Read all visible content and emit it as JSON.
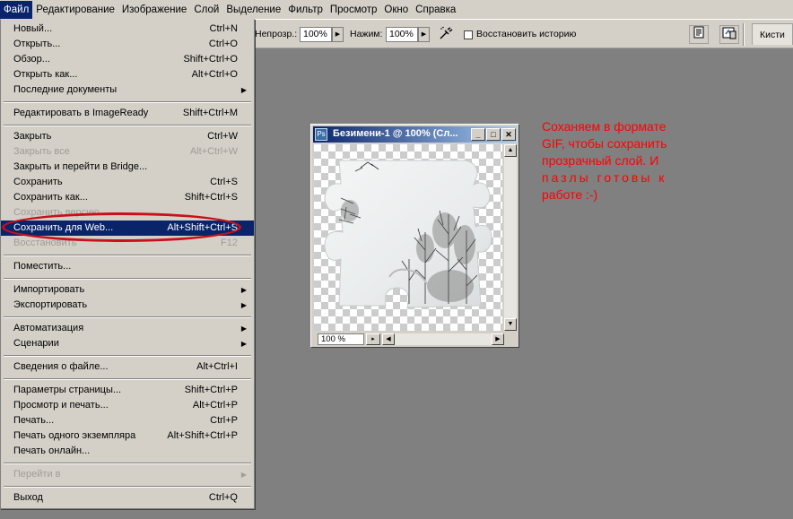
{
  "menubar": {
    "items": [
      "Файл",
      "Редактирование",
      "Изображение",
      "Слой",
      "Выделение",
      "Фильтр",
      "Просмотр",
      "Окно",
      "Справка"
    ]
  },
  "options": {
    "opacity_label": "Непрозр.:",
    "opacity_value": "100%",
    "flow_label": "Нажим:",
    "flow_value": "100%",
    "restore_history_label": "Восстановить историю",
    "brushes_tab": "Кисти"
  },
  "file_menu": {
    "new": {
      "label": "Новый...",
      "shortcut": "Ctrl+N"
    },
    "open": {
      "label": "Открыть...",
      "shortcut": "Ctrl+O"
    },
    "browse": {
      "label": "Обзор...",
      "shortcut": "Shift+Ctrl+O"
    },
    "open_as": {
      "label": "Открыть как...",
      "shortcut": "Alt+Ctrl+O"
    },
    "recent": {
      "label": "Последние документы"
    },
    "edit_imageready": {
      "label": "Редактировать в ImageReady",
      "shortcut": "Shift+Ctrl+M"
    },
    "close": {
      "label": "Закрыть",
      "shortcut": "Ctrl+W"
    },
    "close_all": {
      "label": "Закрыть все",
      "shortcut": "Alt+Ctrl+W"
    },
    "close_bridge": {
      "label": "Закрыть и перейти в Bridge..."
    },
    "save": {
      "label": "Сохранить",
      "shortcut": "Ctrl+S"
    },
    "save_as": {
      "label": "Сохранить как...",
      "shortcut": "Shift+Ctrl+S"
    },
    "save_version": {
      "label": "Сохранить версию..."
    },
    "save_web": {
      "label": "Сохранить для Web...",
      "shortcut": "Alt+Shift+Ctrl+S"
    },
    "revert": {
      "label": "Восстановить",
      "shortcut": "F12"
    },
    "place": {
      "label": "Поместить..."
    },
    "import": {
      "label": "Импортировать"
    },
    "export": {
      "label": "Экспортировать"
    },
    "automate": {
      "label": "Автоматизация"
    },
    "scripts": {
      "label": "Сценарии"
    },
    "file_info": {
      "label": "Сведения о файле...",
      "shortcut": "Alt+Ctrl+I"
    },
    "page_setup": {
      "label": "Параметры страницы...",
      "shortcut": "Shift+Ctrl+P"
    },
    "print_preview": {
      "label": "Просмотр и печать...",
      "shortcut": "Alt+Ctrl+P"
    },
    "print": {
      "label": "Печать...",
      "shortcut": "Ctrl+P"
    },
    "print_one": {
      "label": "Печать одного экземпляра",
      "shortcut": "Alt+Shift+Ctrl+P"
    },
    "print_online": {
      "label": "Печать онлайн..."
    },
    "jump_to": {
      "label": "Перейти в"
    },
    "exit": {
      "label": "Выход",
      "shortcut": "Ctrl+Q"
    }
  },
  "document": {
    "title": "Безимени-1 @ 100% (Сл...",
    "zoom": "100 %"
  },
  "annotation": {
    "lines": [
      "Соханяем в формате",
      "GIF, чтобы сохранить",
      "прозрачный слой. И",
      "пазлы готовы к",
      "работе :-)"
    ]
  },
  "colors": {
    "menu_highlight": "#0a246a",
    "annotation_red": "#ff0000",
    "ellipse_red": "#c8101a",
    "workspace": "#808080"
  }
}
